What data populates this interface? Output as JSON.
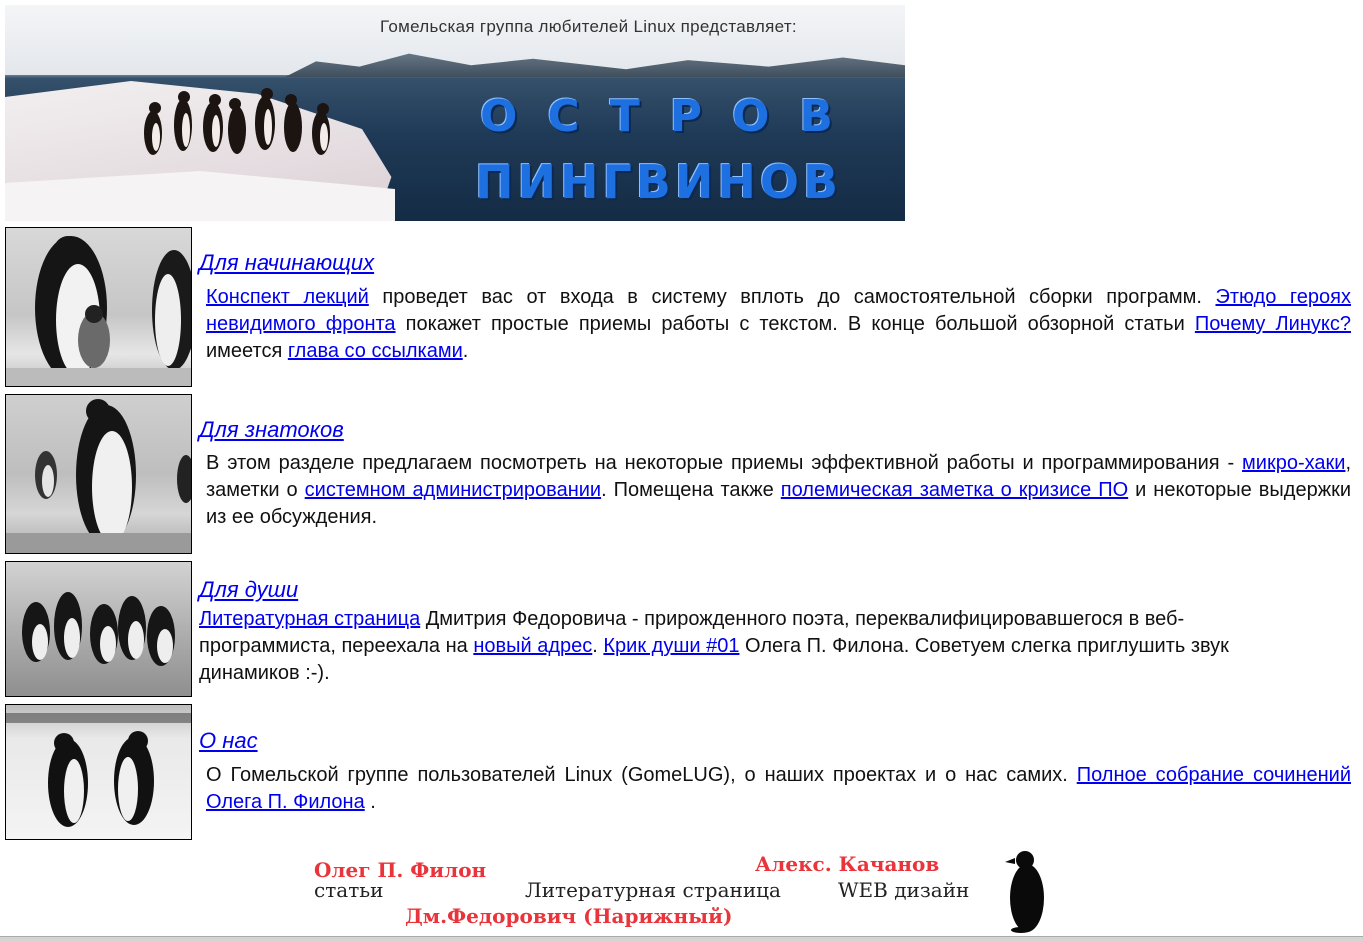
{
  "banner": {
    "caption": "Гомельская группа любителей Linux представляет:",
    "title_line1": "ОСТРОВ",
    "title_line2": "ПИНГВИНОВ"
  },
  "sections": [
    {
      "title": "Для начинающих",
      "parts": [
        {
          "link": "Конспект лекций"
        },
        {
          "text": " проведет вас от входа в систему вплоть до самостоятельной сборки программ. "
        },
        {
          "link": "Этюдо героях невидимого фронта"
        },
        {
          "text": " покажет простые приемы работы с текстом. В конце большой обзорной статьи "
        },
        {
          "link": "Почему Линукс?"
        },
        {
          "text": " имеется "
        },
        {
          "link": "глава со ссылками"
        },
        {
          "text": "."
        }
      ]
    },
    {
      "title": "Для знатоков",
      "parts": [
        {
          "text": "В этом разделе предлагаем посмотреть на некоторые приемы эффективной работы и программирования - "
        },
        {
          "link": "микро-хаки"
        },
        {
          "text": ", заметки о "
        },
        {
          "link": "системном администрировании"
        },
        {
          "text": ". Помещена также "
        },
        {
          "link": "полемическая заметка о кризисе ПО"
        },
        {
          "text": " и некоторые выдержки из ее обсуждения."
        }
      ]
    },
    {
      "title": "Для души",
      "parts": [
        {
          "link": "Литературная страница"
        },
        {
          "text": " Дмитрия Федоровича - прирожденного поэта, переквалифицировавшегося в веб-программиста, переехала на "
        },
        {
          "link": "новый адрес"
        },
        {
          "text": ". "
        },
        {
          "link": "Крик души #01"
        },
        {
          "text": " Олега П. Филона. Советуем слегка приглушить звук динамиков :-)."
        }
      ]
    },
    {
      "title": "О нас",
      "parts": [
        {
          "text": "О Гомельской группе пользователей Linux (GomeLUG), о наших проектах и о нас самих. "
        },
        {
          "link": "Полное собрание сочинений"
        },
        {
          "text": " "
        },
        {
          "link": "Олега П. Филона"
        },
        {
          "text": " ."
        }
      ]
    }
  ],
  "footer": {
    "author1_name": "Олег П. Филон",
    "author1_role": "статьи",
    "author2_name": "Алекс. Качанов",
    "author2_role": "WEB дизайн",
    "center_role": "Литературная страница",
    "author3_name": "Дм.Федорович (Нарижный)"
  },
  "colors": {
    "link": "#0000ee",
    "title_blue": "#1e6fe0",
    "footer_red": "#e8343a"
  }
}
